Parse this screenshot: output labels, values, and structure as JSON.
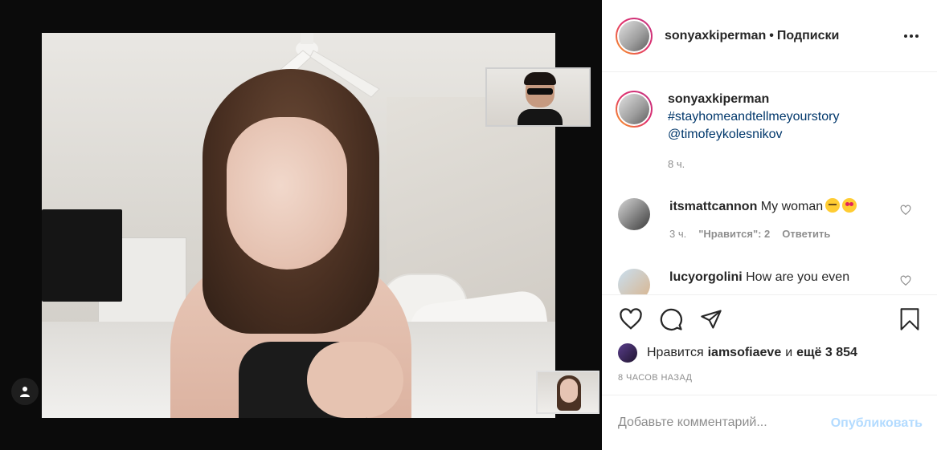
{
  "header": {
    "username": "sonyaxkiperman",
    "separator": "•",
    "follow_label": "Подписки",
    "more_icon": "more-dots-icon"
  },
  "caption": {
    "username": "sonyaxkiperman",
    "hashtag": "#stayhomeandtellmeyourstory",
    "mention": "@timofeykolesnikov",
    "time": "8 ч."
  },
  "comments": [
    {
      "username": "itsmattcannon",
      "text": "My woman",
      "emoji_1": "sleepy-face-emoji",
      "emoji_2": "heart-eyes-emoji",
      "time": "3 ч.",
      "likes_label": "\"Нравится\": 2",
      "reply_label": "Ответить"
    },
    {
      "username": "lucyorgolini",
      "text": "How are you even"
    }
  ],
  "actions": {
    "like_icon": "heart-icon",
    "comment_icon": "comment-icon",
    "share_icon": "send-icon",
    "save_icon": "bookmark-icon"
  },
  "likes": {
    "prefix": "Нравится",
    "user": "iamsofiaeve",
    "conj": "и",
    "others": "ещё 3 854"
  },
  "posted_ago": "8 ЧАСОВ НАЗАД",
  "add_comment": {
    "placeholder": "Добавьте комментарий...",
    "publish_label": "Опубликовать"
  },
  "colors": {
    "link": "#00376b",
    "muted": "#8e8e8e",
    "publish_disabled": "#b3dbff"
  }
}
